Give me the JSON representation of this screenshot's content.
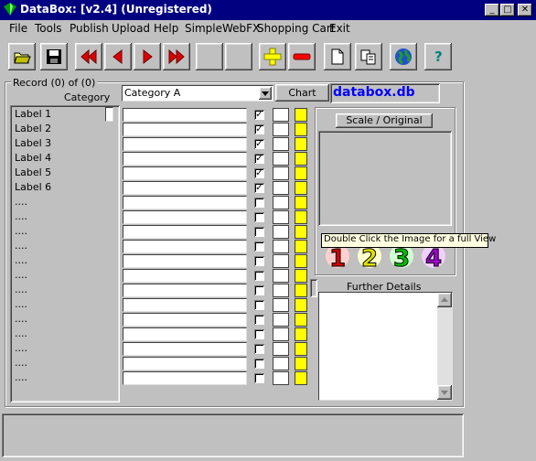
{
  "window": {
    "title": "DataBox: [v2.4] (Unregistered)",
    "min": "_",
    "max": "□",
    "close": "✕"
  },
  "menu": [
    "File",
    "Tools",
    "Publish",
    "Upload",
    "Help",
    "SimpleWebFX",
    "Shopping Cart",
    "Exit"
  ],
  "toolbar": {
    "help_label": "?"
  },
  "record": {
    "group_label": "Record (0) of (0)",
    "category_label": "Category"
  },
  "category": {
    "selected": "Category A",
    "chart_label": "Chart",
    "db_name": "databox.db"
  },
  "labels": [
    "Label 1",
    "Label 2",
    "Label 3",
    "Label 4",
    "Label 5",
    "Label 6",
    "....",
    "....",
    "....",
    "....",
    "....",
    "....",
    "....",
    "....",
    "....",
    "....",
    "....",
    "....",
    "...."
  ],
  "checked": [
    true,
    true,
    true,
    true,
    true,
    true,
    false,
    false,
    false,
    false,
    false,
    false,
    false,
    false,
    false,
    false,
    false,
    false,
    false
  ],
  "image_panel": {
    "scale_button": "Scale / Original Size",
    "tooltip": "Double Click the Image for a full View",
    "thumbs": [
      "1",
      "2",
      "3",
      "4"
    ]
  },
  "details": {
    "label": "Further Details"
  },
  "colors": {
    "title_bg": "#000080",
    "db_name": "#0000ff",
    "yellow": "#ffff00"
  }
}
